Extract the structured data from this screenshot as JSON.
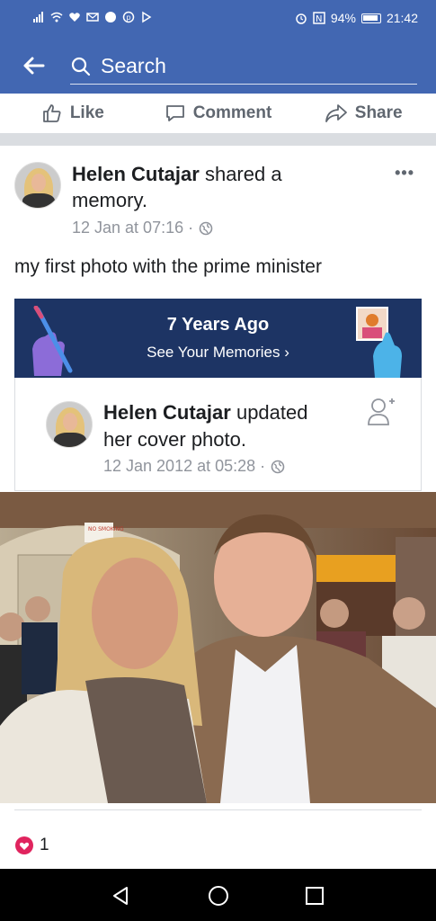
{
  "status_bar": {
    "battery": "94%",
    "time": "21:42"
  },
  "search": {
    "placeholder": "Search"
  },
  "actions": {
    "like": "Like",
    "comment": "Comment",
    "share": "Share"
  },
  "post": {
    "author": "Helen Cutajar",
    "action_text": "shared a",
    "action_text_2": "memory.",
    "timestamp": "12 Jan at 07:16 ·",
    "caption": "my first photo with the prime minister",
    "memories": {
      "years_ago": "7 Years Ago",
      "see_link": "See Your Memories ›"
    },
    "shared": {
      "author": "Helen Cutajar",
      "action_text": "updated",
      "action_text_2": "her cover photo.",
      "timestamp": "12 Jan 2012 at 05:28 ·"
    },
    "photo_sign": "NO SMOKING",
    "reactions": {
      "count": "1"
    }
  },
  "colors": {
    "brand": "#4267b2",
    "memories_bg": "#1d3464",
    "heart": "#e0245e"
  }
}
